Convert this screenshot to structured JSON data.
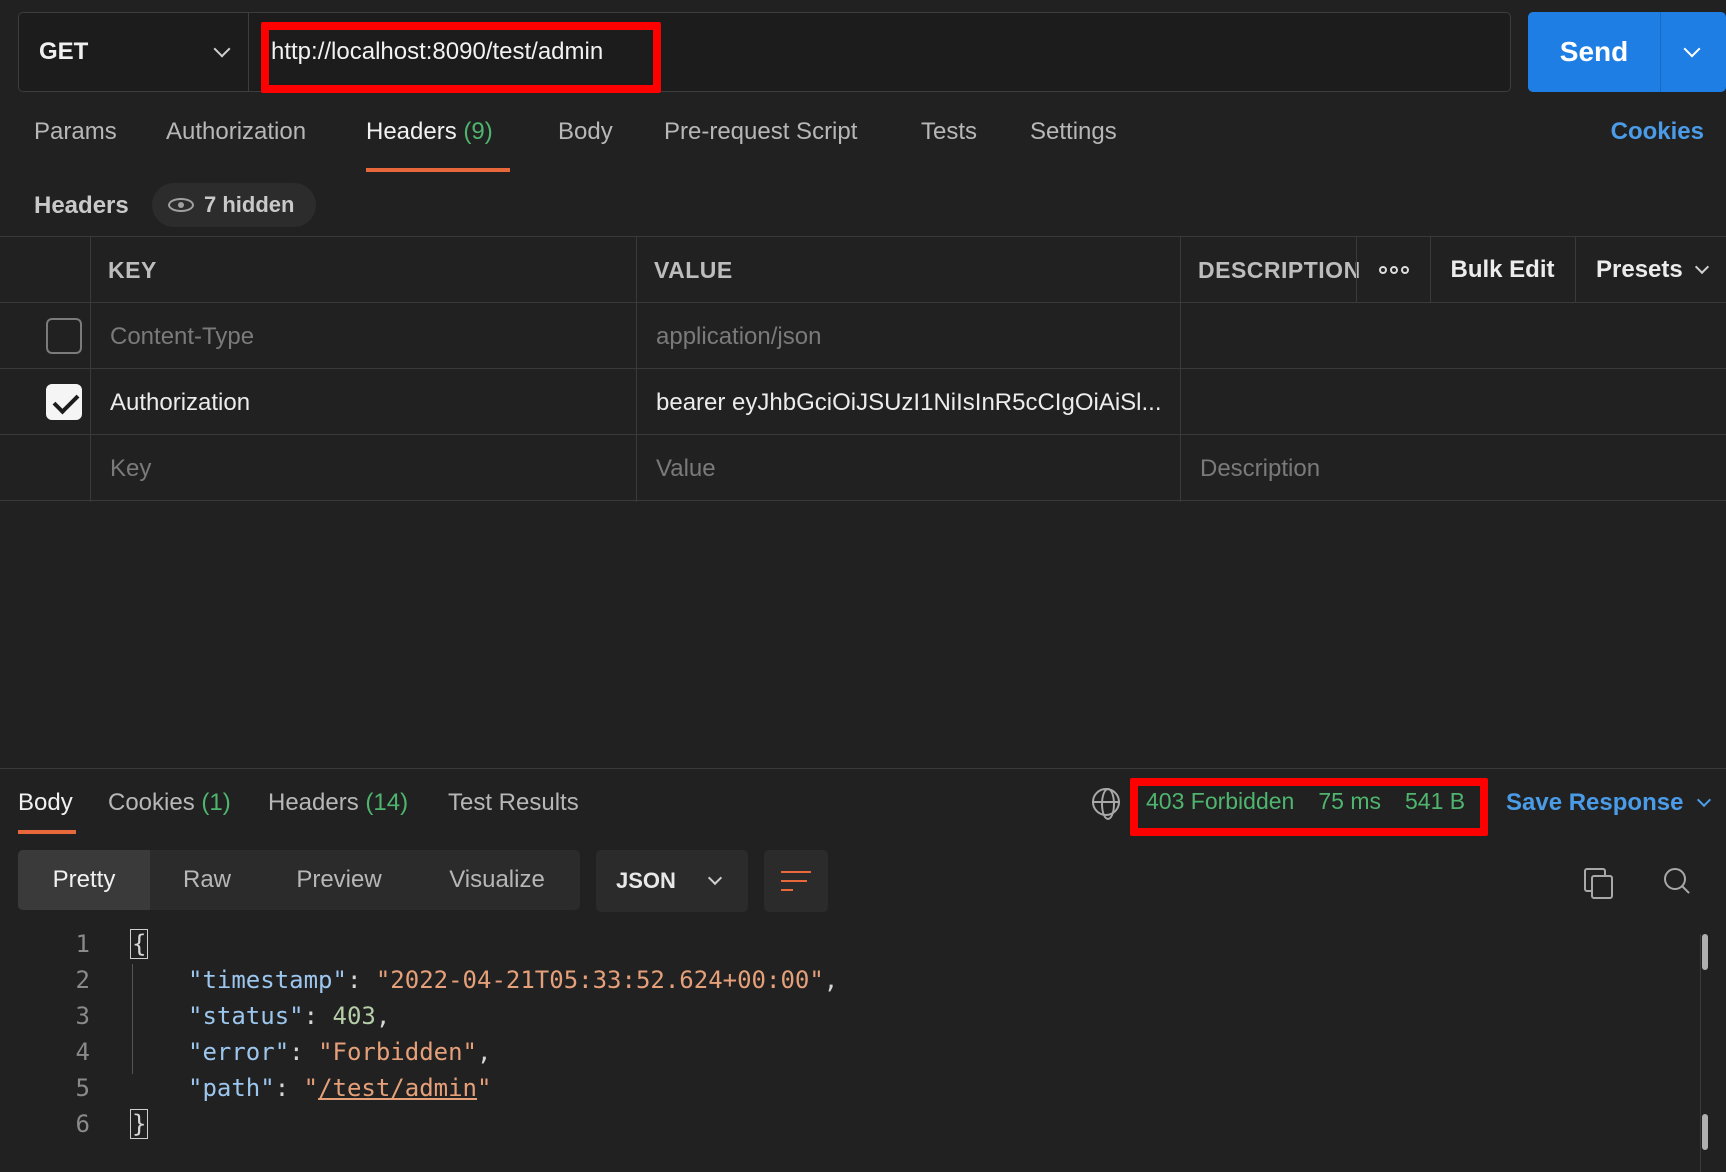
{
  "request": {
    "method": "GET",
    "url": "http://localhost:8090/test/admin",
    "send_label": "Send"
  },
  "request_tabs": {
    "params": "Params",
    "authorization": "Authorization",
    "headers": "Headers",
    "headers_count": "(9)",
    "body": "Body",
    "prerequest": "Pre-request Script",
    "tests": "Tests",
    "settings": "Settings",
    "cookies": "Cookies"
  },
  "headers_section": {
    "title": "Headers",
    "hidden": "7 hidden"
  },
  "headers_table": {
    "columns": {
      "key": "KEY",
      "value": "VALUE",
      "description": "DESCRIPTION"
    },
    "bulk_edit": "Bulk Edit",
    "presets": "Presets",
    "rows": [
      {
        "checked": false,
        "key": "Content-Type",
        "value": "application/json"
      },
      {
        "checked": true,
        "key": "Authorization",
        "value": "bearer eyJhbGciOiJSUzI1NiIsInR5cCIgOiAiSl..."
      }
    ],
    "placeholder": {
      "key": "Key",
      "value": "Value",
      "description": "Description"
    }
  },
  "response_tabs": {
    "body": "Body",
    "cookies": "Cookies",
    "cookies_count": "(1)",
    "headers": "Headers",
    "headers_count": "(14)",
    "test_results": "Test Results"
  },
  "response_status": {
    "status": "403 Forbidden",
    "time": "75 ms",
    "size": "541 B",
    "save": "Save Response"
  },
  "view_modes": {
    "pretty": "Pretty",
    "raw": "Raw",
    "preview": "Preview",
    "visualize": "Visualize",
    "format": "JSON"
  },
  "body_lines": {
    "n1": "1",
    "n2": "2",
    "n3": "3",
    "n4": "4",
    "n5": "5",
    "n6": "6",
    "open": "{",
    "close": "}",
    "k_timestamp": "\"timestamp\"",
    "v_timestamp": "\"2022-04-21T05:33:52.624+00:00\"",
    "k_status": "\"status\"",
    "v_status": "403",
    "k_error": "\"error\"",
    "v_error": "\"Forbidden\"",
    "k_path": "\"path\"",
    "v_path": "/test/admin"
  },
  "colors": {
    "accent_orange": "#e8683b",
    "send_blue": "#1f7ee3",
    "link_blue": "#4b9ce8",
    "success_green": "#4fb56e",
    "highlight_red": "#ff0000"
  }
}
